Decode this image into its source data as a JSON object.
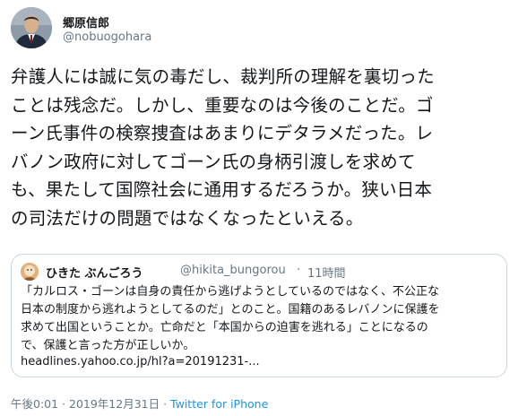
{
  "author": {
    "name": "郷原信郎",
    "handle": "@nobuogohara"
  },
  "tweet": {
    "text": "弁護人には誠に気の毒だし、裁判所の理解を裏切った\nことは残念だ。しかし、重要なのは今後のことだ。ゴ\nーン氏事件の検察捜査はあまりにデタラメだった。レ\nバノン政府に対してゴーン氏の身柄引渡しを求めて\nも、果たして国際社会に通用するだろうか。狭い日本\nの司法だけの問題ではなくなったといえる。"
  },
  "quoted": {
    "name": "ひきた ぶんごろう",
    "handle": "@hikita_bungorou",
    "separator": "·",
    "time": "11時間",
    "text": "「カルロス・ゴーンは自身の責任から逃げようとしているのではなく、不公正な\n日本の制度から逃れようとしてるのだ」とのこと。国籍のあるレバノンに保護を\n求めて出国ということか。亡命だと「本国からの迫害を逃れる」ことになるの\nで、保護と言った方が正しいか。",
    "link": "headlines.yahoo.co.jp/hl?a=20191231-..."
  },
  "footer": {
    "timestamp": "午後0:01 · 2019年12月31日 · ",
    "source": "Twitter for iPhone"
  },
  "colors": {
    "text": "#14171a",
    "secondary": "#657786",
    "link": "#1b95e0",
    "border": "#ccd6dd"
  }
}
